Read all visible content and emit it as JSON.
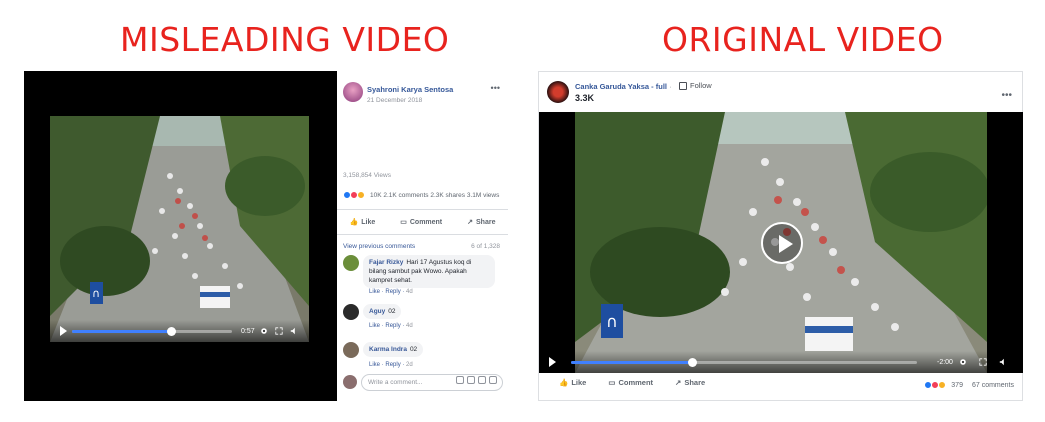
{
  "headings": {
    "left": "MISLEADING VIDEO",
    "right": "ORIGINAL VIDEO"
  },
  "left_post": {
    "author": "Syahroni Karya Sentosa",
    "date": "21 December 2018",
    "views": "3,158,854 Views",
    "stats": "10K   2.1K comments  2.3K shares  3.1M views",
    "actions": [
      "Like",
      "Comment",
      "Share"
    ],
    "view_previous": "View previous comments",
    "comment_count": "6 of 1,328",
    "video_time": "0:57",
    "video_progress": 0.62,
    "comments": [
      {
        "name": "Fajar Rizky",
        "text": "Hari 17 Agustus koq di bilang sambut pak Wowo. Apakah kampret sehat.",
        "like": "Like",
        "reply": "Reply",
        "time": "4d"
      },
      {
        "name": "Aguy",
        "text": "02",
        "like": "Like",
        "reply": "Reply",
        "time": "4d"
      },
      {
        "name": "Karma Indra",
        "text": "02",
        "like": "Like",
        "reply": "Reply",
        "time": "2d"
      }
    ],
    "write_placeholder": "Write a comment..."
  },
  "right_post": {
    "author": "Canka Garuda Yaksa - full",
    "follow": "Follow",
    "views": "3.3K",
    "video_time": "-2:00",
    "video_progress": 0.35,
    "actions": [
      "Like",
      "Comment",
      "Share"
    ],
    "reactions_count": "379",
    "comments_count": "67 comments"
  },
  "colors": {
    "heading_red": "#e8231e",
    "fb_blue": "#365899",
    "progress_blue": "#4080ff"
  }
}
